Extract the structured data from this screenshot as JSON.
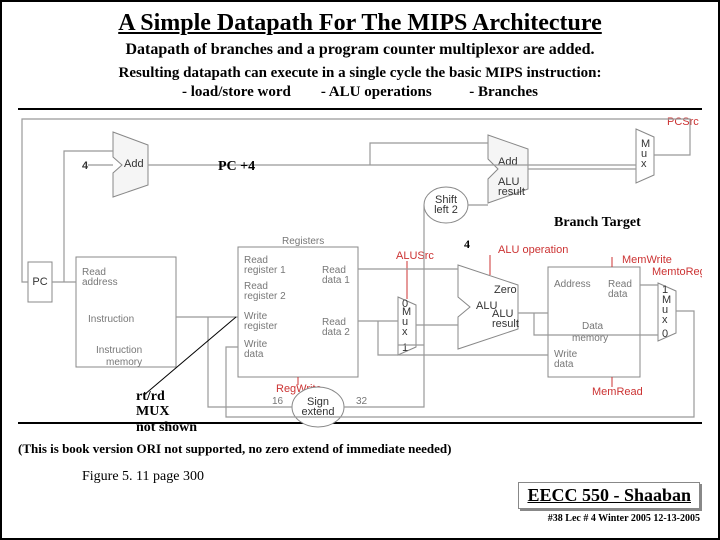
{
  "title": "A Simple Datapath For The MIPS Architecture",
  "subtitle": "Datapath of branches and a program counter multiplexor are added.",
  "line3": "Resulting datapath can execute in a single cycle the basic MIPS instruction:",
  "line4_a": "-  load/store word",
  "line4_b": "-   ALU operations",
  "line4_c": "-  Branches",
  "ann": {
    "pc4": "PC +4",
    "branch_target": "Branch Target",
    "aluop_bits": "4",
    "rtrd1": "rt/rd",
    "rtrd2": "MUX",
    "rtrd3": "not shown"
  },
  "blocks": {
    "pc": "PC",
    "four": "4",
    "add1": "Add",
    "add2": "Add",
    "add2_res": "ALU\nresult",
    "imem_addr": "Read\naddress",
    "imem_out": "Instruction",
    "imem_name": "Instruction\nmemory",
    "regs_name": "Registers",
    "regs_r1": "Read\nregister 1",
    "regs_r2": "Read\nregister 2",
    "regs_wr": "Write\nregister",
    "regs_wd": "Write\ndata",
    "regs_d1": "Read\ndata 1",
    "regs_d2": "Read\ndata 2",
    "shl2": "Shift\nleft 2",
    "signext": "Sign\nextend",
    "signext_in": "16",
    "signext_out": "32",
    "mux": "M\nu\nx",
    "mux0": "0",
    "mux1": "1",
    "alu": "ALU",
    "alu_zero": "Zero",
    "alu_res": "ALU\nresult",
    "dmem_addr": "Address",
    "dmem_wd": "Write\ndata",
    "dmem_rd": "Read\ndata",
    "dmem_name": "Data\nmemory"
  },
  "signals": {
    "pcsrc": "PCSrc",
    "alusrc": "ALUSrc",
    "regwrite": "RegWrite",
    "aluop": "ALU operation",
    "memwrite": "MemWrite",
    "memread": "MemRead",
    "memtoreg": "MemtoReg"
  },
  "footnote": "(This is book version ORI not supported, no zero extend of immediate needed)",
  "figref": "Figure 5. 11 page 300",
  "course": "EECC 550 - Shaaban",
  "lec": "#38   Lec # 4   Winter 2005   12-13-2005"
}
